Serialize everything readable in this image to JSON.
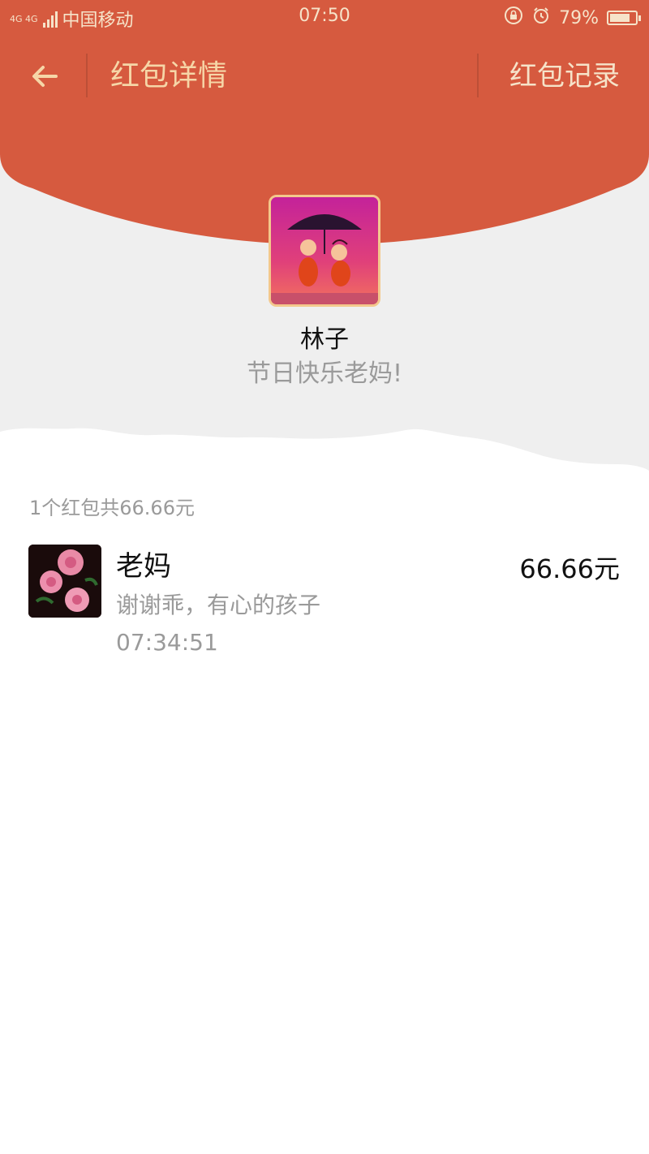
{
  "status_bar": {
    "network": "4G 4G",
    "carrier": "中国移动",
    "time": "07:50",
    "battery_percent": "79%",
    "battery_level": 0.79
  },
  "header": {
    "title": "红包详情",
    "records_link": "红包记录",
    "background_color": "#d65a3f",
    "accent_color": "#f6d6a7"
  },
  "sender": {
    "name": "林子",
    "greeting": "节日快乐老妈!"
  },
  "summary": "1个红包共66.66元",
  "records": [
    {
      "name": "老妈",
      "message": "谢谢乖，有心的孩子",
      "time": "07:34:51",
      "amount": "66.66元"
    }
  ],
  "icons": {
    "back": "back-arrow-icon",
    "lock": "rotation-lock-icon",
    "alarm": "alarm-icon",
    "battery": "battery-icon",
    "signal": "signal-icon"
  }
}
